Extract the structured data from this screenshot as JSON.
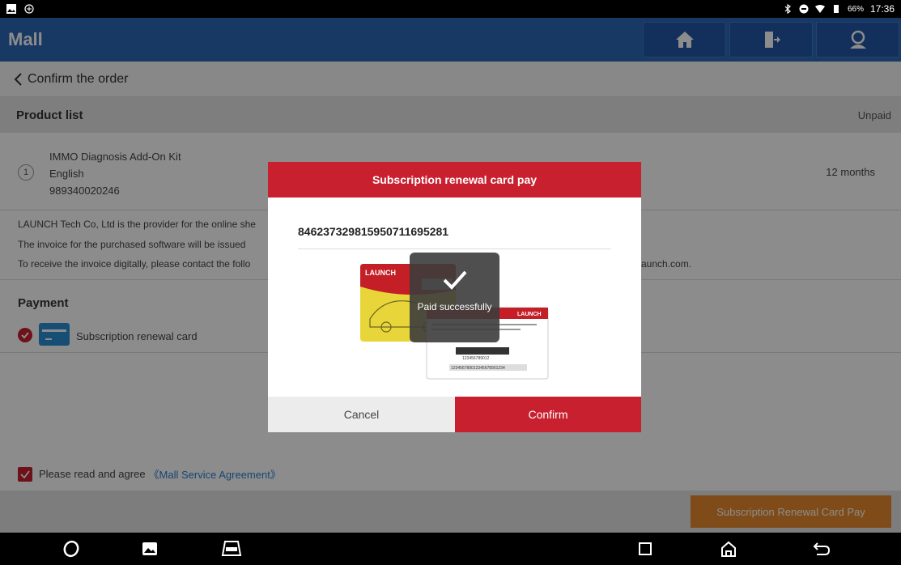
{
  "status_bar": {
    "time": "17:36",
    "battery": "66%"
  },
  "appbar": {
    "title": "Mall",
    "buttons": [
      {
        "icon": "home-icon"
      },
      {
        "icon": "exit-icon"
      },
      {
        "icon": "support-icon"
      }
    ]
  },
  "subbar": {
    "back_label": "Confirm the order"
  },
  "product_list": {
    "header": "Product list",
    "status": "Unpaid",
    "items": [
      {
        "index": "1",
        "name": "IMMO Diagnosis Add-On Kit",
        "language": "English",
        "code": "989340020246",
        "term": "12 months"
      }
    ]
  },
  "notice": {
    "line1": "LAUNCH Tech Co, Ltd is the provider for the online she",
    "line2": "The invoice for the purchased software will be issued",
    "line3": "To receive the invoice digitally, please contact the follo",
    "line3_tail": "aunch.com."
  },
  "payment": {
    "header": "Payment",
    "method": "Subscription renewal card"
  },
  "agreement": {
    "text": "Please read and agree",
    "link": "《Mall Service Agreement》"
  },
  "footer": {
    "pay_button": "Subscription Renewal Card Pay"
  },
  "dialog": {
    "title": "Subscription renewal card pay",
    "card_number": "84623732981595071169528​1",
    "cancel": "Cancel",
    "confirm": "Confirm",
    "card_front_brand": "LAUNCH",
    "card_back_brand": "LAUNCH",
    "card_back_number": "123456789012",
    "card_back_password": "123456789012345678901234"
  },
  "toast": {
    "message": "Paid successfully"
  },
  "colors": {
    "brand_blue": "#2d69b7",
    "accent_red": "#c8202e",
    "pay_orange": "#e88a2e"
  }
}
